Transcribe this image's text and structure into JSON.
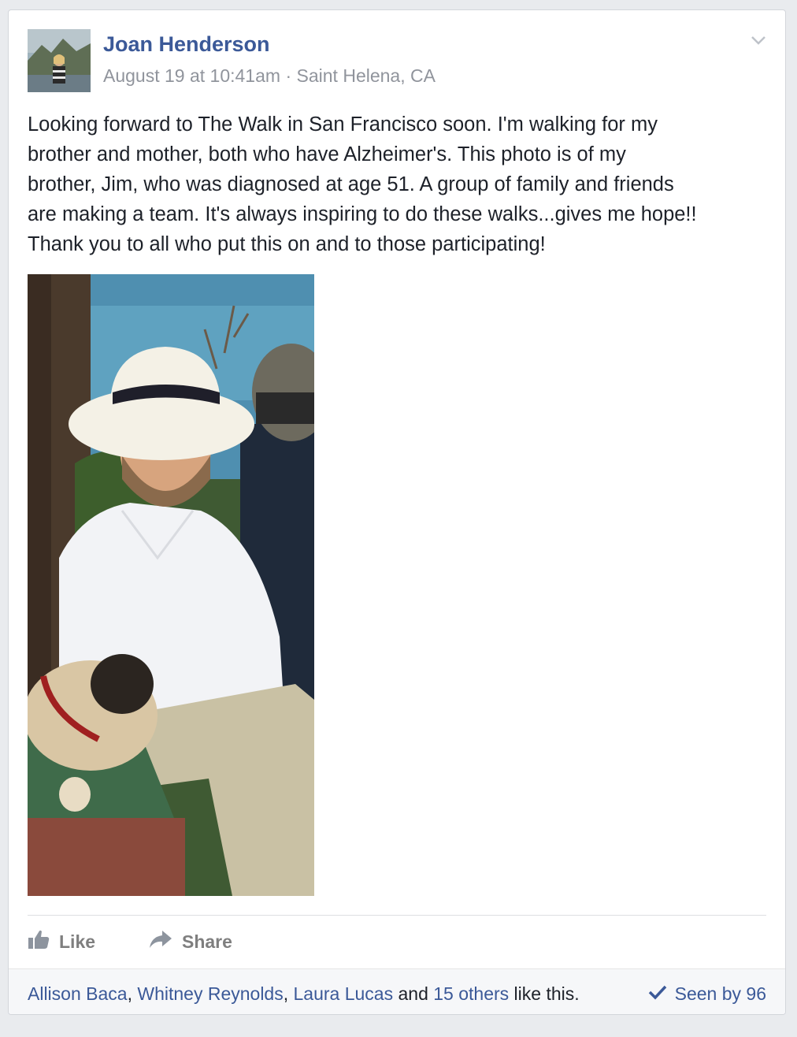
{
  "post": {
    "author": "Joan Henderson",
    "timestamp": "August 19 at 10:41am",
    "separator": " · ",
    "location": "Saint Helena, CA",
    "text_lines": [
      "Looking forward to The Walk in San Francisco soon. I'm walking for my",
      "brother and mother, both who have Alzheimer's. This photo is of my",
      "brother, Jim, who was diagnosed at age 51. A group of family and friends",
      "are making a team. It's always inspiring to do these walks...gives me hope!!",
      "Thank you to all who put this on and to those participating!"
    ]
  },
  "actions": {
    "like_label": "Like",
    "share_label": "Share"
  },
  "footer": {
    "likers": [
      "Allison Baca",
      "Whitney Reynolds",
      "Laura Lucas"
    ],
    "comma": ", ",
    "and_text": " and ",
    "others": "15 others",
    "like_suffix": " like this.",
    "seen_label": "Seen by 96"
  },
  "colors": {
    "link_blue": "#3b5998",
    "text": "#1d2129",
    "meta_gray": "#90949c",
    "action_gray": "#7f7f7f",
    "footer_bg": "#f6f7f9"
  },
  "icons": [
    "chevron-down-icon",
    "thumbs-up-icon",
    "share-arrow-icon",
    "checkmark-icon"
  ]
}
